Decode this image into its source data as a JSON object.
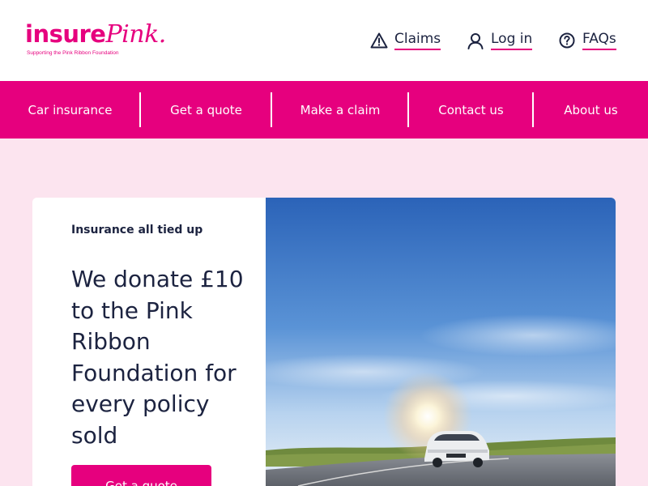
{
  "header": {
    "logo": {
      "word1": "insure",
      "word2": "Pink.",
      "tagline": "Supporting the Pink Ribbon Foundation"
    },
    "utility_links": [
      {
        "label": "Claims",
        "icon": "warning-triangle-icon"
      },
      {
        "label": "Log in",
        "icon": "user-icon"
      },
      {
        "label": "FAQs",
        "icon": "question-circle-icon"
      }
    ]
  },
  "nav": {
    "items": [
      {
        "label": "Car insurance"
      },
      {
        "label": "Get a quote"
      },
      {
        "label": "Make a claim"
      },
      {
        "label": "Contact us"
      },
      {
        "label": "About us"
      }
    ]
  },
  "hero": {
    "eyebrow": "Insurance all tied up",
    "headline": "We donate £10 to the Pink Ribbon Foundation for every policy sold",
    "cta_label": "Get a quote",
    "image_description": "car-on-road-under-blue-sky"
  },
  "colors": {
    "brand_pink": "#e6007e",
    "page_background": "#fce4ef",
    "text_dark": "#1c2340",
    "white": "#ffffff"
  }
}
